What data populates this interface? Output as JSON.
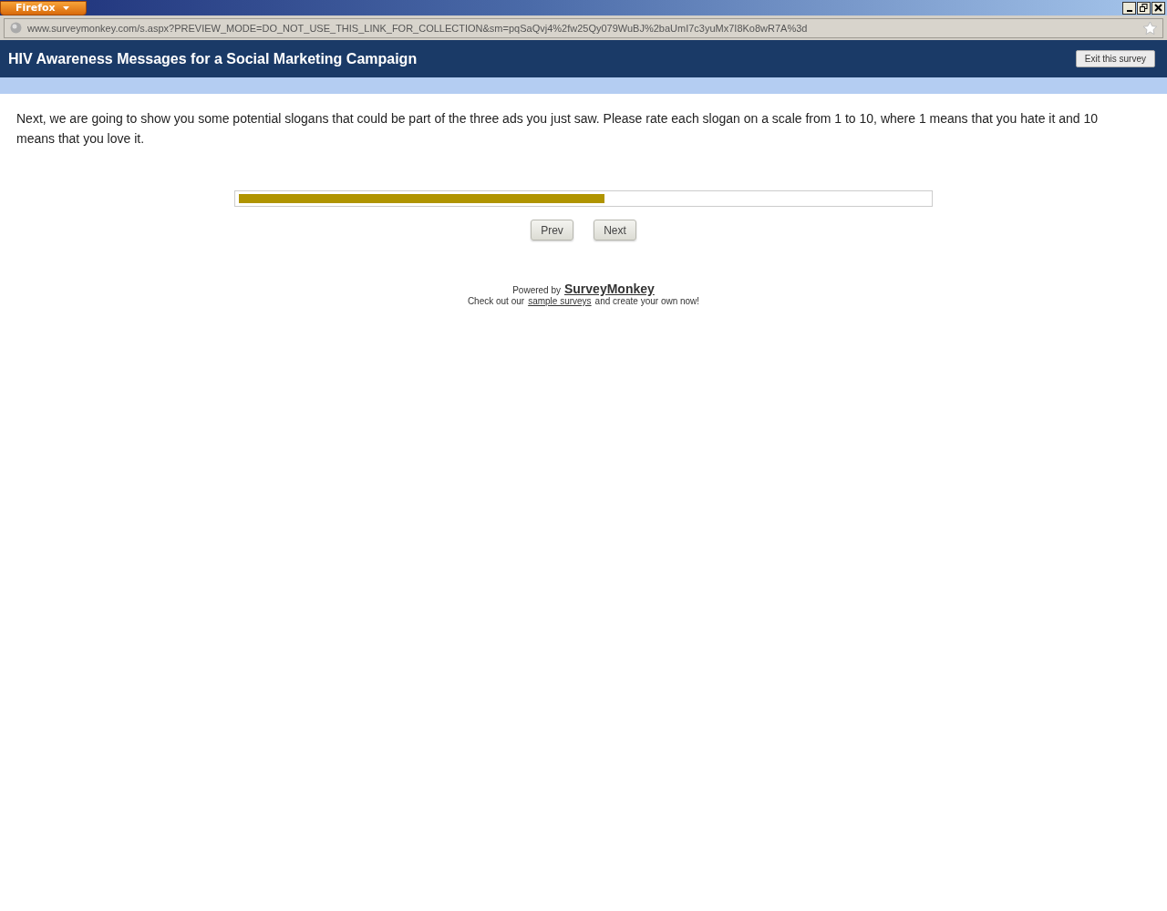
{
  "browser": {
    "menu_label": "Firefox",
    "url": "www.surveymonkey.com/s.aspx?PREVIEW_MODE=DO_NOT_USE_THIS_LINK_FOR_COLLECTION&sm=pqSaQvj4%2fw25Qy079WuBJ%2baUmI7c3yuMx7I8Ko8wR7A%3d"
  },
  "header": {
    "title": "HIV Awareness Messages for a Social Marketing Campaign",
    "exit_button": "Exit this survey"
  },
  "intro": "Next, we are going to show you some potential slogans that could be part of the three ads you just saw. Please rate each slogan on a scale from 1 to 10, where 1 means that you hate it and 10 means that you love it.",
  "progress": {
    "level": 0.53
  },
  "buttons": [
    "Prev",
    "Next"
  ],
  "footer": {
    "powered_by": "Powered by",
    "brand_link": "SurveyMonkey",
    "line_start": "Check out our",
    "line_link": "sample surveys",
    "line_end": "and create your own now!"
  }
}
